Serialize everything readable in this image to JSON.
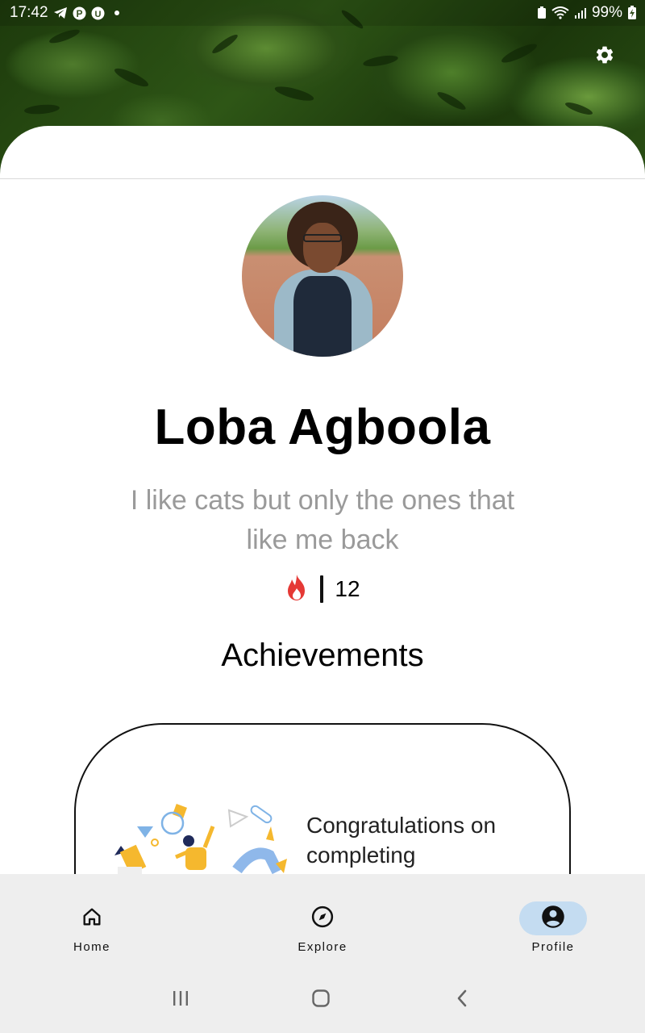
{
  "status_bar": {
    "time": "17:42",
    "battery": "99%",
    "left_icons": [
      "telegram-icon",
      "pinterest-icon",
      "upwork-icon"
    ],
    "right_icons": [
      "battery-saver-icon",
      "wifi-icon",
      "signal-icon",
      "battery-charging-icon"
    ]
  },
  "header": {
    "settings_icon": "gear-icon"
  },
  "profile": {
    "name": "Loba Agboola",
    "bio": "I like cats but only the ones that like me back",
    "streak_icon": "fire-icon",
    "streak_count": "12"
  },
  "achievements": {
    "title": "Achievements",
    "cards": [
      {
        "text": "Congratulations on completing"
      }
    ]
  },
  "bottom_nav": {
    "items": [
      {
        "label": "Home",
        "icon": "home-icon",
        "active": false
      },
      {
        "label": "Explore",
        "icon": "compass-icon",
        "active": false
      },
      {
        "label": "Profile",
        "icon": "account-circle-icon",
        "active": true
      }
    ]
  },
  "system_nav": {
    "buttons": [
      "recents-icon",
      "home-circle-icon",
      "back-icon"
    ]
  },
  "colors": {
    "accent_pill": "#c4dcf1",
    "nav_background": "#eeeeee",
    "bio_text": "#9a9a9a",
    "fire": "#e53935"
  }
}
